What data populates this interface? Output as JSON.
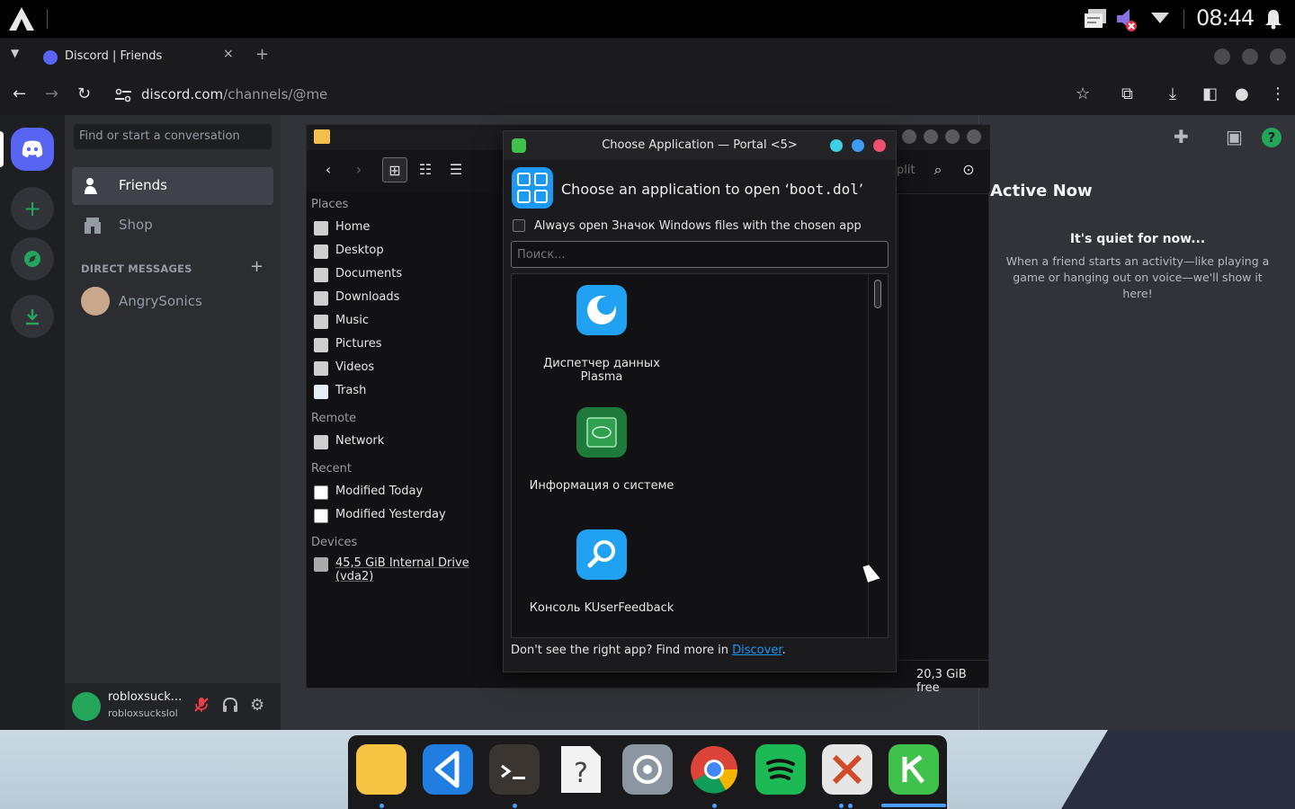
{
  "system_bar": {
    "clock": "08:44"
  },
  "browser": {
    "tab": {
      "title": "Discord | Friends",
      "close": "×"
    },
    "new_tab": "+",
    "url_host": "discord.com",
    "url_path": "/channels/@me"
  },
  "discord": {
    "search_placeholder": "Find or start a conversation",
    "nav": [
      {
        "label": "Friends"
      },
      {
        "label": "Shop"
      }
    ],
    "dm_header": "DIRECT MESSAGES",
    "dm_add": "+",
    "dms": [
      {
        "name": "AngrySonics"
      }
    ],
    "user": {
      "display": "robloxsuck...",
      "username": "robloxsuckslol"
    },
    "active_now": {
      "title": "Active Now",
      "quiet": "It's quiet for now...",
      "desc": "When a friend starts an activity—like playing a game or hanging out on voice—we'll show it here!"
    }
  },
  "file_manager": {
    "sections": {
      "places": "Places",
      "remote": "Remote",
      "recent": "Recent",
      "devices": "Devices"
    },
    "places": [
      "Home",
      "Desktop",
      "Documents",
      "Downloads",
      "Music",
      "Pictures",
      "Videos",
      "Trash"
    ],
    "remote": [
      "Network"
    ],
    "recent": [
      "Modified Today",
      "Modified Yesterday"
    ],
    "devices": [
      "45,5 GiB Internal Drive (vda2)"
    ],
    "split_label": "plit",
    "free_space": "20,3 GiB free"
  },
  "dialog": {
    "title": "Choose Application — Portal <5>",
    "heading_prefix": "Choose an application to open ‘",
    "heading_file": "boot.dol",
    "heading_suffix": "’",
    "always_open": "Always open Значок Windows files with the chosen app",
    "search_placeholder": "Поиск...",
    "apps": [
      {
        "name": "Диспетчер данных Plasma"
      },
      {
        "name": "Информация о системе"
      },
      {
        "name": "Консоль KUserFeedback"
      }
    ],
    "footer_prefix": "Don't see the right app? Find more in ",
    "footer_link": "Discover",
    "footer_suffix": "."
  },
  "colors": {
    "discord_blurple": "#5865f2",
    "discord_green": "#23a55a",
    "kde_blue": "#1d99f3",
    "dot_cyan": "#3ccfe6",
    "dot_blue": "#3d9cf2",
    "dot_red": "#f0506e"
  }
}
